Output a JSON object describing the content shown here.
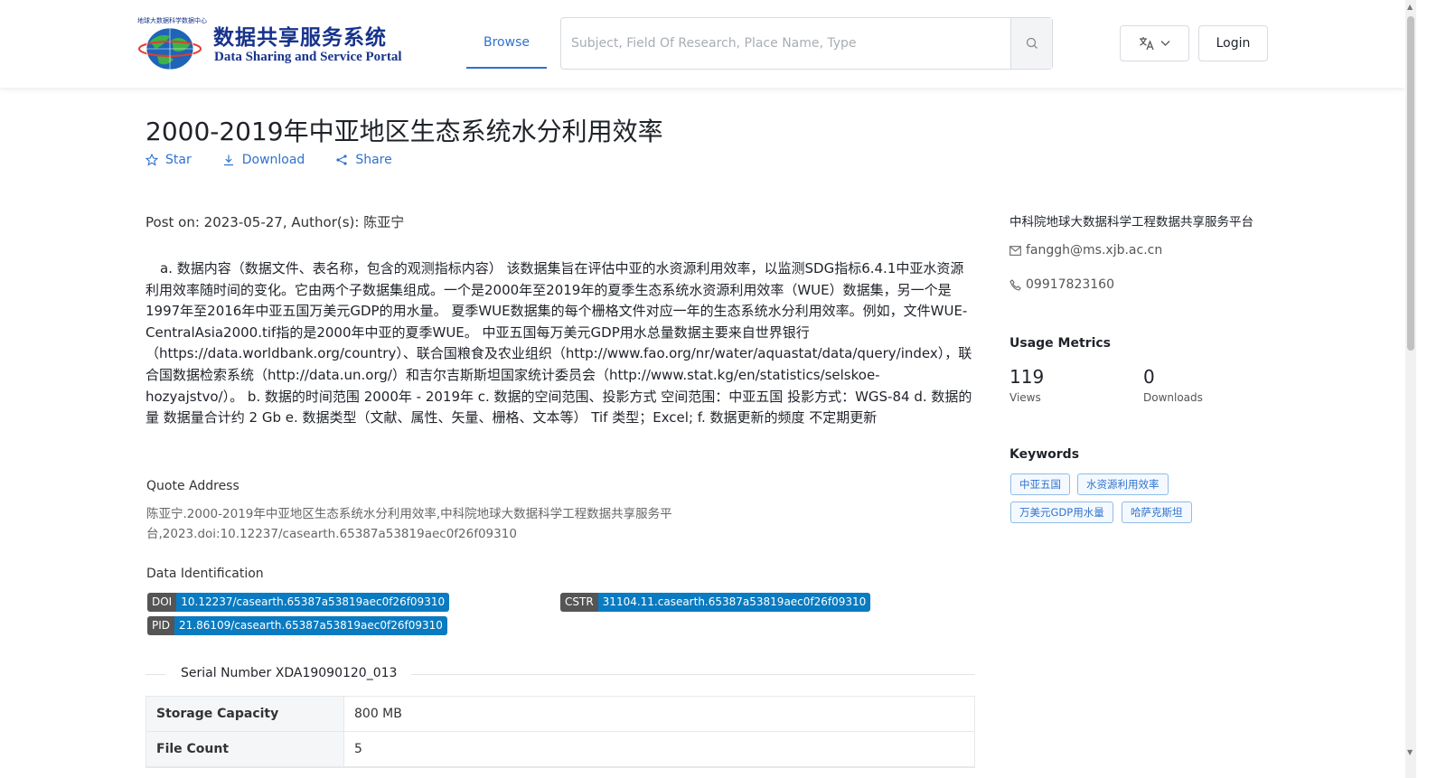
{
  "header": {
    "logo_cn": "数据共享服务系统",
    "logo_en": "Data Sharing and Service Portal",
    "logo_arc": "地球大数据科学数据中心",
    "nav_browse": "Browse",
    "search_placeholder": "Subject, Field Of Research, Place Name, Type",
    "login_label": "Login",
    "lang_icon": "translate-icon"
  },
  "dataset": {
    "title": "2000-2019年中亚地区生态系统水分利用效率",
    "actions": {
      "star": "Star",
      "download": "Download",
      "share": "Share"
    },
    "post_on": "Post on: 2023-05-27, Author(s): 陈亚宁",
    "description": "a. 数据内容（数据文件、表名称，包含的观测指标内容） 该数据集旨在评估中亚的水资源利用效率，以监测SDG指标6.4.1中亚水资源利用效率随时间的变化。它由两个子数据集组成。一个是2000年至2019年的夏季生态系统水资源利用效率（WUE）数据集，另一个是1997年至2016年中亚五国万美元GDP的用水量。 夏季WUE数据集的每个栅格文件对应一年的生态系统水分利用效率。例如，文件WUE-CentralAsia2000.tif指的是2000年中亚的夏季WUE。 中亚五国每万美元GDP用水总量数据主要来自世界银行（https://data.worldbank.org/country）、联合国粮食及农业组织（http://www.fao.org/nr/water/aquastat/data/query/index），联合国数据检索系统（http://data.un.org/）和吉尔吉斯斯坦国家统计委员会（http://www.stat.kg/en/statistics/selskoe-hozyajstvo/）。 b. 数据的时间范围 2000年 - 2019年 c. 数据的空间范围、投影方式 空间范围：中亚五国 投影方式：WGS-84 d. 数据的量 数据量合计约 2 Gb e. 数据类型（文献、属性、矢量、栅格、文本等） Tif 类型；Excel; f. 数据更新的频度 不定期更新",
    "quote_label": "Quote Address",
    "quote_text": "陈亚宁.2000-2019年中亚地区生态系统水分利用效率,中科院地球大数据科学工程数据共享服务平台,2023.doi:10.12237/casearth.65387a53819aec0f26f09310",
    "ident_label": "Data Identification",
    "doi_key": "DOI",
    "doi_value": "10.12237/casearth.65387a53819aec0f26f09310",
    "cstr_key": "CSTR",
    "cstr_value": "31104.11.casearth.65387a53819aec0f26f09310",
    "pid_key": "PID",
    "pid_value": "21.86109/casearth.65387a53819aec0f26f09310",
    "serial": "Serial Number XDA19090120_013",
    "table": [
      {
        "key": "Storage Capacity",
        "value": "800 MB"
      },
      {
        "key": "File Count",
        "value": "5"
      }
    ]
  },
  "sidebar": {
    "org": "中科院地球大数据科学工程数据共享服务平台",
    "email": "fanggh@ms.xjb.ac.cn",
    "phone": "09917823160",
    "metrics_title": "Usage Metrics",
    "views_count": "119",
    "views_label": "Views",
    "downloads_count": "0",
    "downloads_label": "Downloads",
    "keywords_title": "Keywords",
    "keywords": [
      "中亚五国",
      "水资源利用效率",
      "万美元GDP用水量",
      "哈萨克斯坦"
    ]
  },
  "colors": {
    "accent": "#2f72ce",
    "badge_value": "#0a7bc1",
    "badge_key": "#555555",
    "logo": "#17338c"
  }
}
